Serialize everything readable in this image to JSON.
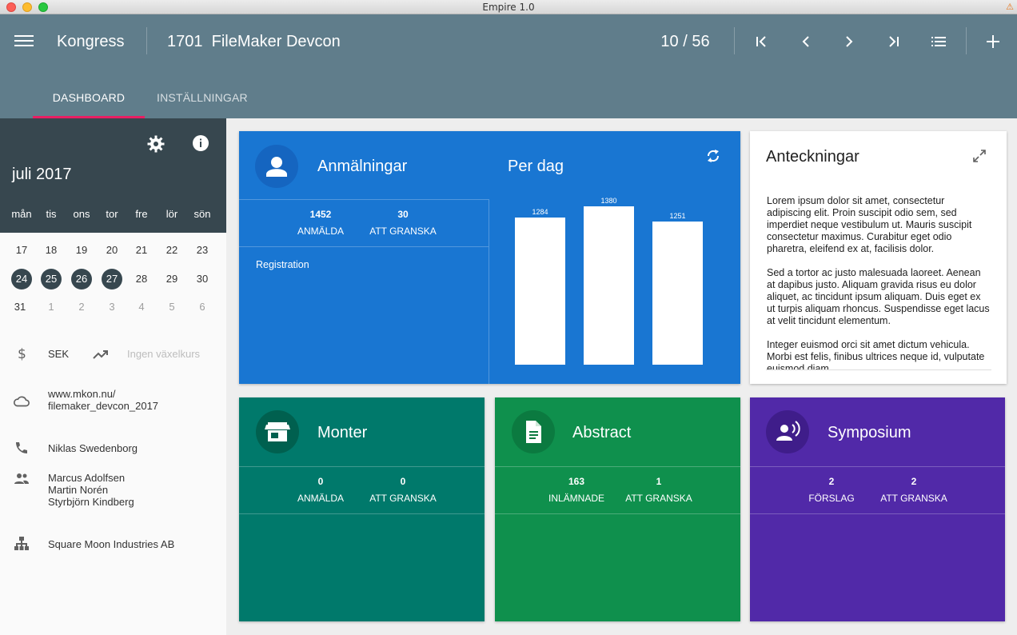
{
  "window": {
    "title": "Empire 1.0"
  },
  "appbar": {
    "section": "Kongress",
    "record_title": "1701  FileMaker Devcon",
    "counter": "10 / 56",
    "tabs": [
      {
        "label": "DASHBOARD",
        "active": true
      },
      {
        "label": "INSTÄLLNINGAR",
        "active": false
      }
    ]
  },
  "calendar": {
    "month": "juli 2017",
    "weekdays": [
      "mån",
      "tis",
      "ons",
      "tor",
      "fre",
      "lör",
      "sön"
    ],
    "weeks": [
      [
        "17",
        "18",
        "19",
        "20",
        "21",
        "22",
        "23"
      ],
      [
        "24",
        "25",
        "26",
        "27",
        "28",
        "29",
        "30"
      ],
      [
        "31",
        "1",
        "2",
        "3",
        "4",
        "5",
        "6"
      ]
    ],
    "selected_days": [
      "24",
      "25",
      "26",
      "27"
    ]
  },
  "sidebar": {
    "currency": "SEK",
    "exchange_rate": "Ingen växelkurs",
    "url_line1": "www.mkon.nu/",
    "url_line2": "filemaker_devcon_2017",
    "contact": "Niklas Swedenborg",
    "team": [
      "Marcus Adolfsen",
      "Martin Norén",
      "Styrbjörn Kindberg"
    ],
    "organization": "Square Moon Industries AB"
  },
  "cards": {
    "anmalningar": {
      "title": "Anmälningar",
      "stats": [
        {
          "value": "1452",
          "label": "ANMÄLDA"
        },
        {
          "value": "30",
          "label": "ATT GRANSKA"
        }
      ],
      "sub_label": "Registration",
      "chart_title": "Per dag"
    },
    "monter": {
      "title": "Monter",
      "stats": [
        {
          "value": "0",
          "label": "ANMÄLDA"
        },
        {
          "value": "0",
          "label": "ATT GRANSKA"
        }
      ]
    },
    "abstract": {
      "title": "Abstract",
      "stats": [
        {
          "value": "163",
          "label": "INLÄMNADE"
        },
        {
          "value": "1",
          "label": "ATT GRANSKA"
        }
      ]
    },
    "symposium": {
      "title": "Symposium",
      "stats": [
        {
          "value": "2",
          "label": "FÖRSLAG"
        },
        {
          "value": "2",
          "label": "ATT GRANSKA"
        }
      ]
    }
  },
  "notes": {
    "title": "Anteckningar",
    "paragraphs": [
      "Lorem ipsum dolor sit amet, consectetur adipiscing elit. Proin suscipit odio sem, sed imperdiet neque vestibulum ut. Mauris suscipit consectetur maximus. Curabitur eget odio pharetra, eleifend ex at, facilisis dolor.",
      "Sed a tortor ac justo malesuada laoreet. Aenean at dapibus justo. Aliquam gravida risus eu dolor aliquet, ac tincidunt ipsum aliquam. Duis eget ex ut turpis aliquam rhoncus. Suspendisse eget lacus at velit tincidunt elementum.",
      "Integer euismod orci sit amet dictum vehicula. Morbi est felis, finibus ultrices neque id, vulputate euismod diam."
    ]
  },
  "colors": {
    "appbar": "#607d8b",
    "calendar_header": "#37474f",
    "tab_indicator": "#e91e63",
    "anmalningar": "#1976d2",
    "monter": "#00796b",
    "abstract": "#0f904d",
    "symposium": "#5129a8"
  },
  "chart_data": {
    "type": "bar",
    "title": "Per dag",
    "categories": [
      "",
      "",
      ""
    ],
    "values": [
      1284,
      1380,
      1251
    ],
    "ylim": [
      0,
      1380
    ],
    "grid": false
  }
}
